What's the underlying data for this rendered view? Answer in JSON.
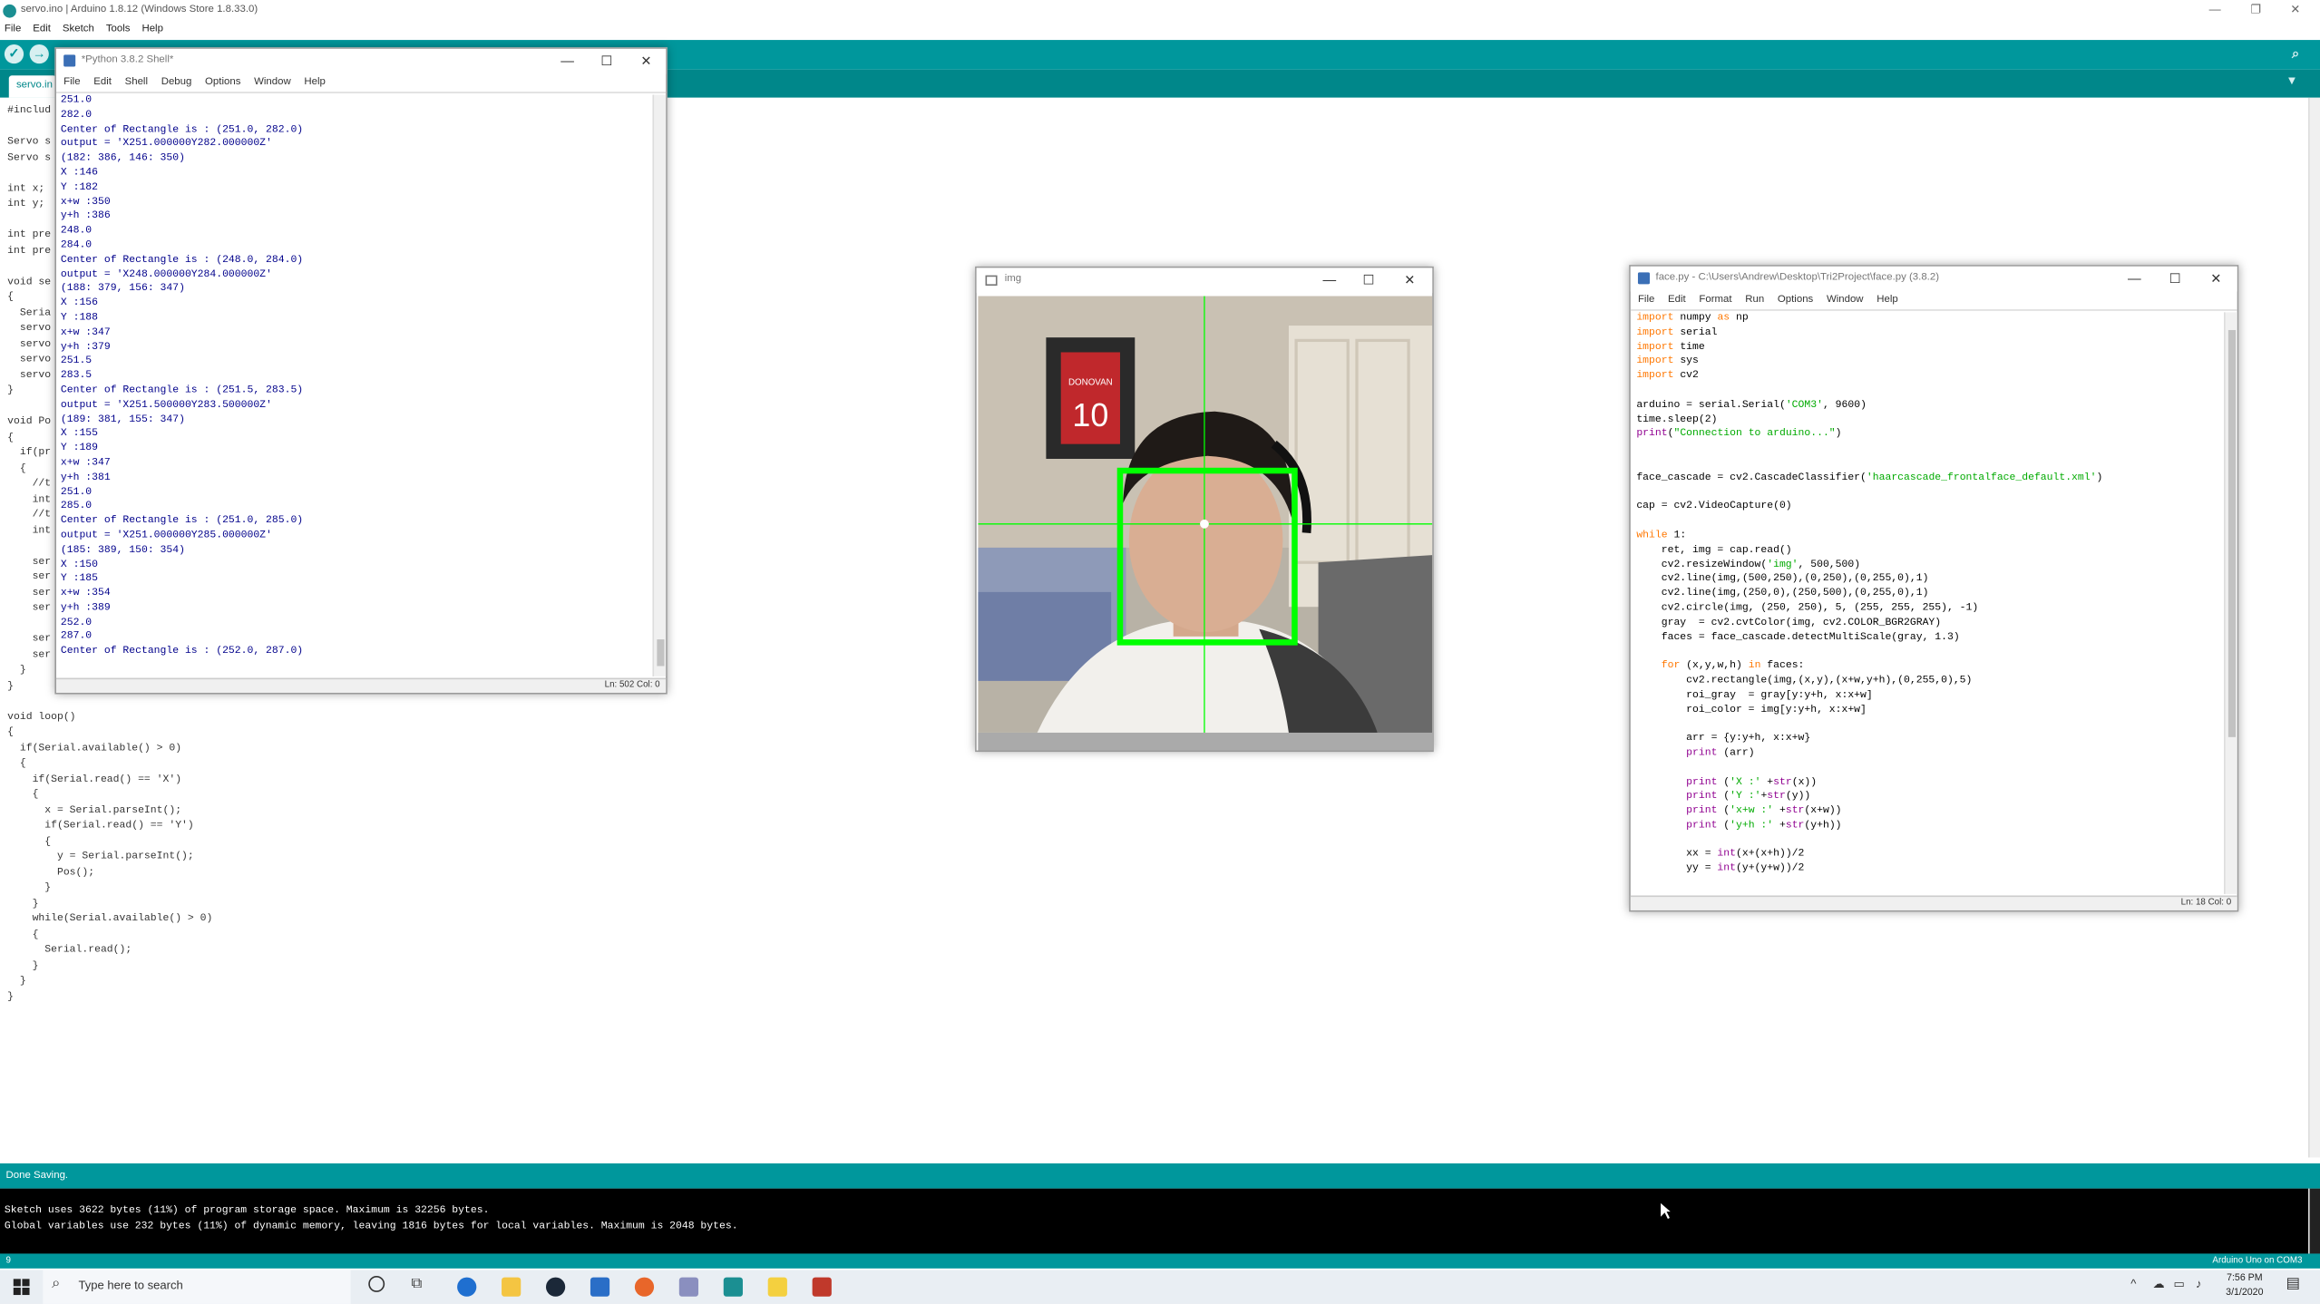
{
  "arduino": {
    "title": "servo.ino | Arduino 1.8.12 (Windows Store 1.8.33.0)",
    "menu": [
      "File",
      "Edit",
      "Sketch",
      "Tools",
      "Help"
    ],
    "tab": "servo.in",
    "code_lines": [
      "#includ",
      "",
      "Servo s",
      "Servo s",
      "",
      "int x;",
      "int y;",
      "",
      "int pre",
      "int pre",
      "",
      "void se",
      "{",
      "  Seria",
      "  servo",
      "  servo",
      "  servo",
      "  servo",
      "}",
      "",
      "void Po",
      "{",
      "  if(pr",
      "  {",
      "    //t",
      "    int",
      "    //t",
      "    int",
      "",
      "    ser",
      "    ser",
      "    ser",
      "    ser",
      "",
      "    ser",
      "    ser",
      "  }",
      "}",
      "",
      "void loop()",
      "{",
      "  if(Serial.available() > 0)",
      "  {",
      "    if(Serial.read() == 'X')",
      "    {",
      "      x = Serial.parseInt();",
      "      if(Serial.read() == 'Y')",
      "      {",
      "        y = Serial.parseInt();",
      "        Pos();",
      "      }",
      "    }",
      "    while(Serial.available() > 0)",
      "    {",
      "      Serial.read();",
      "    }",
      "  }",
      "}"
    ],
    "status": "Done Saving.",
    "console": [
      "Sketch uses 3622 bytes (11%) of program storage space. Maximum is 32256 bytes.",
      "Global variables use 232 bytes (11%) of dynamic memory, leaving 1816 bytes for local variables. Maximum is 2048 bytes."
    ],
    "footer_line": "9",
    "footer_board": "Arduino Uno on COM3"
  },
  "shell": {
    "title": "*Python 3.8.2 Shell*",
    "menu": [
      "File",
      "Edit",
      "Shell",
      "Debug",
      "Options",
      "Window",
      "Help"
    ],
    "lines": [
      "251.0",
      "282.0",
      "Center of Rectangle is : (251.0, 282.0)",
      "output = 'X251.000000Y282.000000Z'",
      "(182: 386, 146: 350)",
      "X :146",
      "Y :182",
      "x+w :350",
      "y+h :386",
      "248.0",
      "284.0",
      "Center of Rectangle is : (248.0, 284.0)",
      "output = 'X248.000000Y284.000000Z'",
      "(188: 379, 156: 347)",
      "X :156",
      "Y :188",
      "x+w :347",
      "y+h :379",
      "251.5",
      "283.5",
      "Center of Rectangle is : (251.5, 283.5)",
      "output = 'X251.500000Y283.500000Z'",
      "(189: 381, 155: 347)",
      "X :155",
      "Y :189",
      "x+w :347",
      "y+h :381",
      "251.0",
      "285.0",
      "Center of Rectangle is : (251.0, 285.0)",
      "output = 'X251.000000Y285.000000Z'",
      "(185: 389, 150: 354)",
      "X :150",
      "Y :185",
      "x+w :354",
      "y+h :389",
      "252.0",
      "287.0",
      "Center of Rectangle is : (252.0, 287.0)"
    ],
    "status": "Ln: 502   Col: 0"
  },
  "img": {
    "title": "img",
    "photo": {
      "subject": "person",
      "jersey_text": "DONOVAN",
      "jersey_number": "10"
    }
  },
  "editor": {
    "title": "face.py - C:\\Users\\Andrew\\Desktop\\Tri2Project\\face.py (3.8.2)",
    "menu": [
      "File",
      "Edit",
      "Format",
      "Run",
      "Options",
      "Window",
      "Help"
    ],
    "status": "Ln: 18   Col: 0"
  },
  "taskbar": {
    "search_placeholder": "Type here to search",
    "time": "7:56 PM",
    "date": "3/1/2020"
  }
}
